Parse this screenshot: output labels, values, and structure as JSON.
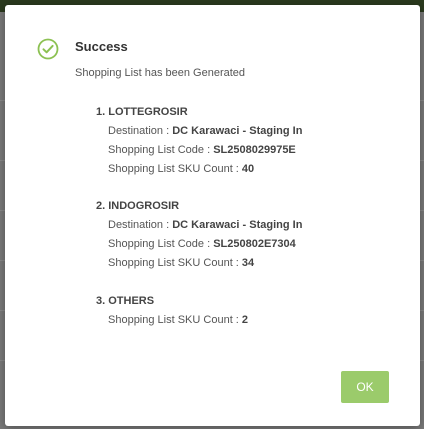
{
  "colors": {
    "accent": "#8cc152",
    "ok_button_bg": "#9bcb6b",
    "modal_bg": "#ffffff",
    "backdrop": "#7a7a7a"
  },
  "dialog": {
    "icon": "check-circle-icon",
    "title": "Success",
    "message": "Shopping List has been Generated",
    "ok_label": "OK"
  },
  "groups": [
    {
      "heading": "1. LOTTEGROSIR",
      "destination_label": "Destination :",
      "destination": "DC Karawaci - Staging In",
      "code_label": "Shopping List Code :",
      "code": "SL2508029975E",
      "sku_label": "Shopping List SKU Count :",
      "sku_count": "40"
    },
    {
      "heading": "2. INDOGROSIR",
      "destination_label": "Destination :",
      "destination": "DC Karawaci - Staging In",
      "code_label": "Shopping List Code :",
      "code": "SL250802E7304",
      "sku_label": "Shopping List SKU Count :",
      "sku_count": "34"
    },
    {
      "heading": "3. OTHERS",
      "sku_label": "Shopping List SKU Count :",
      "sku_count": "2"
    }
  ]
}
